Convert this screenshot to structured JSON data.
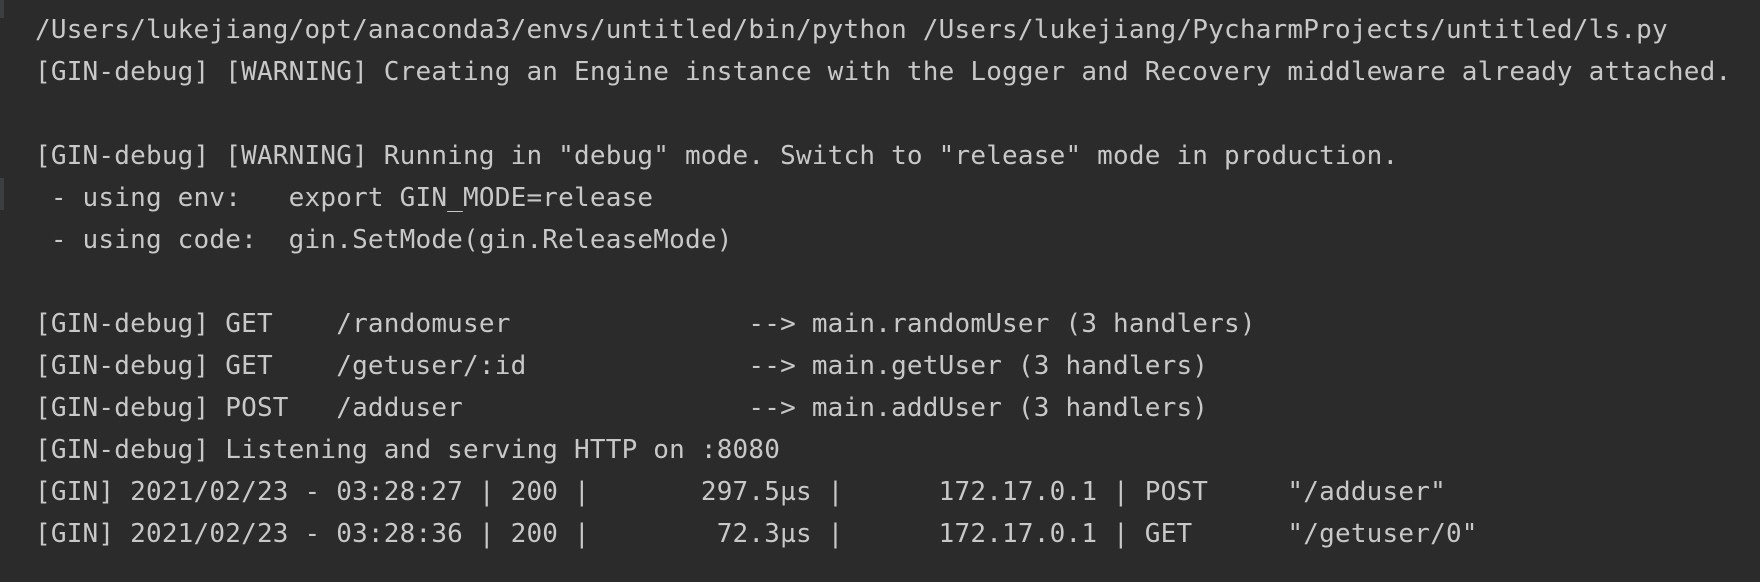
{
  "console": {
    "lines": [
      "/Users/lukejiang/opt/anaconda3/envs/untitled/bin/python /Users/lukejiang/PycharmProjects/untitled/ls.py",
      "[GIN-debug] [WARNING] Creating an Engine instance with the Logger and Recovery middleware already attached.",
      "",
      "[GIN-debug] [WARNING] Running in \"debug\" mode. Switch to \"release\" mode in production.",
      " - using env:   export GIN_MODE=release",
      " - using code:  gin.SetMode(gin.ReleaseMode)",
      "",
      "[GIN-debug] GET    /randomuser               --> main.randomUser (3 handlers)",
      "[GIN-debug] GET    /getuser/:id              --> main.getUser (3 handlers)",
      "[GIN-debug] POST   /adduser                  --> main.addUser (3 handlers)",
      "[GIN-debug] Listening and serving HTTP on :8080",
      "[GIN] 2021/02/23 - 03:28:27 | 200 |       297.5µs |      172.17.0.1 | POST     \"/adduser\"",
      "[GIN] 2021/02/23 - 03:28:36 | 200 |        72.3µs |      172.17.0.1 | GET      \"/getuser/0\""
    ]
  }
}
